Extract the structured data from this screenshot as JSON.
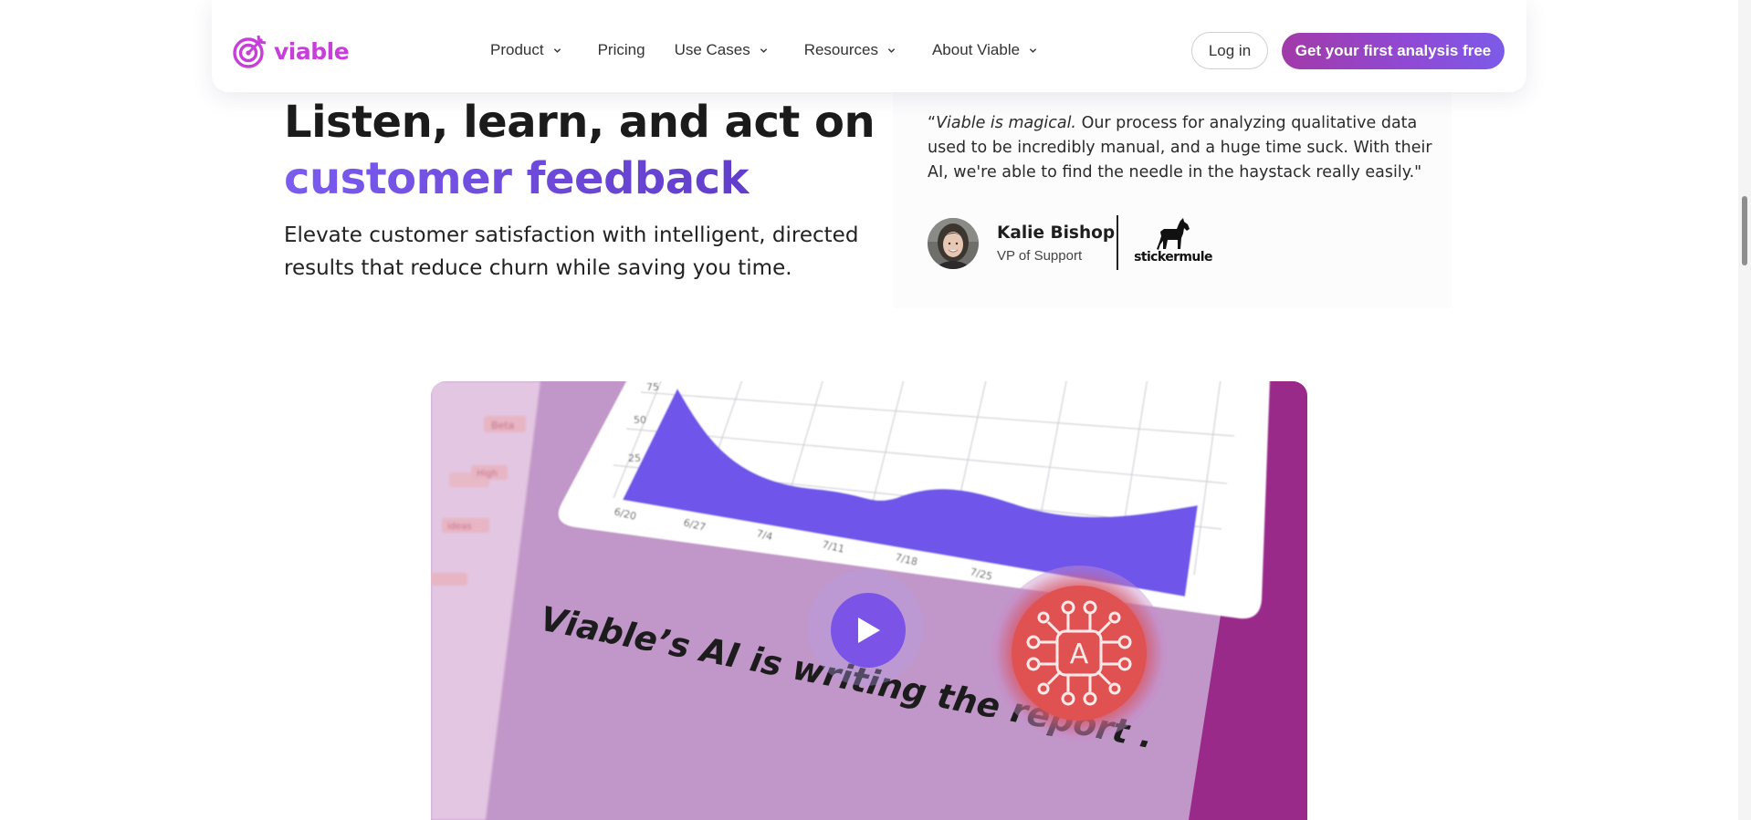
{
  "nav": {
    "logo_text": "viable",
    "links": [
      {
        "label": "Product",
        "has_dropdown": true
      },
      {
        "label": "Pricing",
        "has_dropdown": false
      },
      {
        "label": "Use Cases",
        "has_dropdown": true
      },
      {
        "label": "Resources",
        "has_dropdown": true
      },
      {
        "label": "About Viable",
        "has_dropdown": true
      }
    ],
    "login_label": "Log in",
    "cta_label": "Get your first analysis free"
  },
  "hero": {
    "title_line1": "Listen, learn, and act on",
    "title_line2": "customer feedback",
    "subtitle": "Elevate customer satisfaction with intelligent, directed results that reduce churn while saving you time."
  },
  "testimonial": {
    "quote_open": "“",
    "quote_emphasis": "Viable is magical.",
    "quote_rest": " Our process for analyzing qualitative data used to be incredibly manual, and a huge time suck. With their AI, we're able to find the needle in the haystack really easily.\"",
    "name": "Kalie Bishop",
    "role": "VP of Support",
    "company": "stickermule"
  },
  "video": {
    "caption": "Viable’s AI is writing the report .",
    "badge_letter": "A",
    "chart_y_ticks": [
      "75",
      "50",
      "25"
    ],
    "chart_x_ticks": [
      "6/20",
      "6/27",
      "7/4",
      "7/11",
      "7/18",
      "7/25"
    ],
    "sidebar_words": [
      "Beta",
      "High",
      "ideas"
    ]
  },
  "colors": {
    "brand_magenta": "#c63fd8",
    "headline_purple": "#6b47d6",
    "cta_gradient_start": "#a23aa9",
    "cta_gradient_end": "#7c5be8",
    "video_bg": "#c196c8",
    "chart_fill": "#6f55ea",
    "ai_badge": "#e05252",
    "play_button": "#7b53e6"
  },
  "icons": {
    "logo": "target-arrow-icon",
    "dropdown": "chevron-down-icon",
    "play": "play-icon",
    "ai_badge": "neural-network-icon",
    "company": "horse-icon"
  }
}
